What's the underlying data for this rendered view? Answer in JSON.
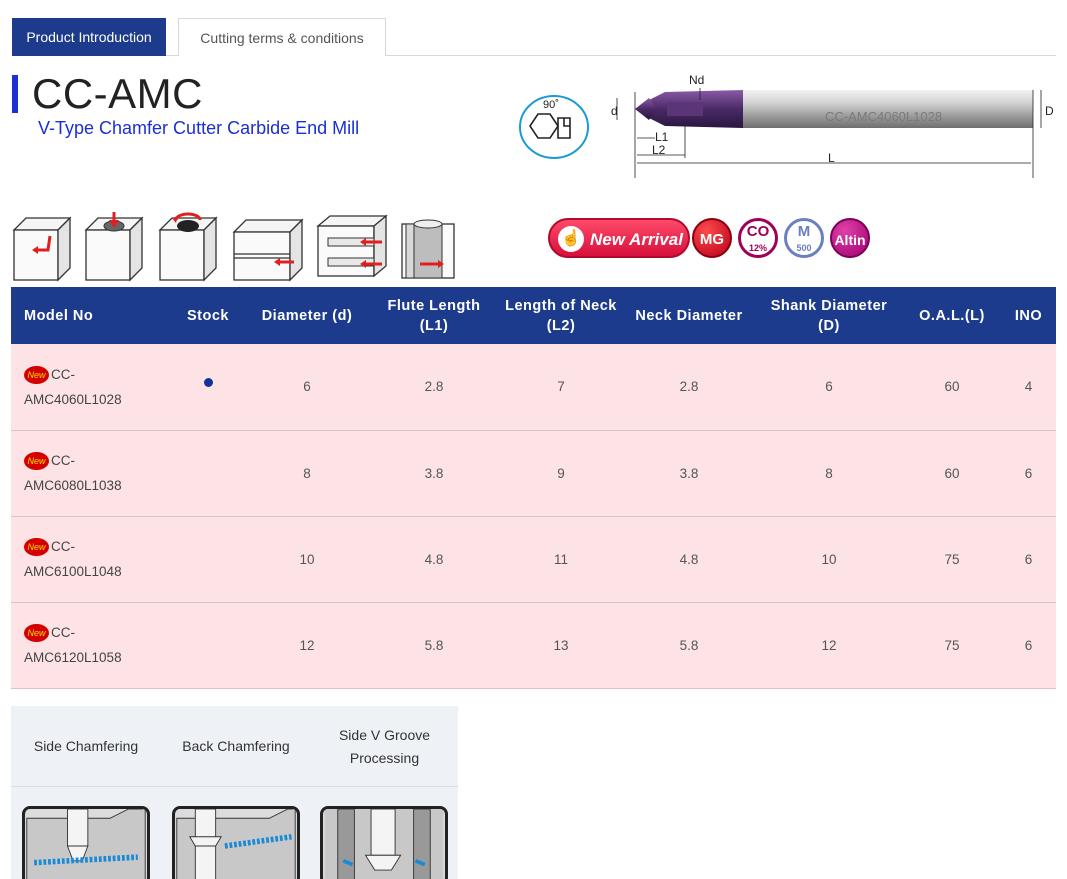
{
  "tabs": {
    "product_intro": "Product Introduction",
    "cutting_terms": "Cutting terms & conditions"
  },
  "header": {
    "title": "CC-AMC",
    "subtitle": "V-Type Chamfer Cutter Carbide End Mill",
    "angle_label": "90˚"
  },
  "drawing": {
    "label_nd": "Nd",
    "label_d": "d",
    "label_D": "D",
    "label_L1": "L1",
    "label_L2": "L2",
    "label_L": "L",
    "shank_engraving": "CC-AMC4060L1028"
  },
  "badges": {
    "new_arrival": "New Arrival",
    "mg": "MG",
    "co": "CO",
    "co_sub": "12%",
    "m": "M",
    "m_sub": "500",
    "altin": "Altin",
    "colors": {
      "new_arrival": "#e0143f",
      "mg": "#d9001b",
      "co": "#a0005a",
      "m": "#6a7fc4",
      "altin": "#b4007a"
    }
  },
  "table": {
    "headers": [
      "Model No",
      "Stock",
      "Diameter (d)",
      "Flute Length (L1)",
      "Length of Neck (L2)",
      "Neck Diameter",
      "Shank Diameter (D)",
      "O.A.L.(L)",
      "INO"
    ],
    "new_tag": "New",
    "rows": [
      {
        "model_a": "CC-",
        "model_b": "AMC4060L1028",
        "stock": true,
        "d": "6",
        "l1": "2.8",
        "l2": "7",
        "nd": "2.8",
        "D": "6",
        "L": "60",
        "ino": "4"
      },
      {
        "model_a": "CC-",
        "model_b": "AMC6080L1038",
        "stock": false,
        "d": "8",
        "l1": "3.8",
        "l2": "9",
        "nd": "3.8",
        "D": "8",
        "L": "60",
        "ino": "6"
      },
      {
        "model_a": "CC-",
        "model_b": "AMC6100L1048",
        "stock": false,
        "d": "10",
        "l1": "4.8",
        "l2": "11",
        "nd": "4.8",
        "D": "10",
        "L": "75",
        "ino": "6"
      },
      {
        "model_a": "CC-",
        "model_b": "AMC6120L1058",
        "stock": false,
        "d": "12",
        "l1": "5.8",
        "l2": "13",
        "nd": "5.8",
        "D": "12",
        "L": "75",
        "ino": "6"
      }
    ]
  },
  "applications": {
    "side": "Side Chamfering",
    "back": "Back Chamfering",
    "groove_1": "Side V Groove",
    "groove_2": "Processing"
  },
  "colors": {
    "primary": "#1c3b8c",
    "accent": "#1a2fd4",
    "row_bg": "#fde3e6"
  }
}
